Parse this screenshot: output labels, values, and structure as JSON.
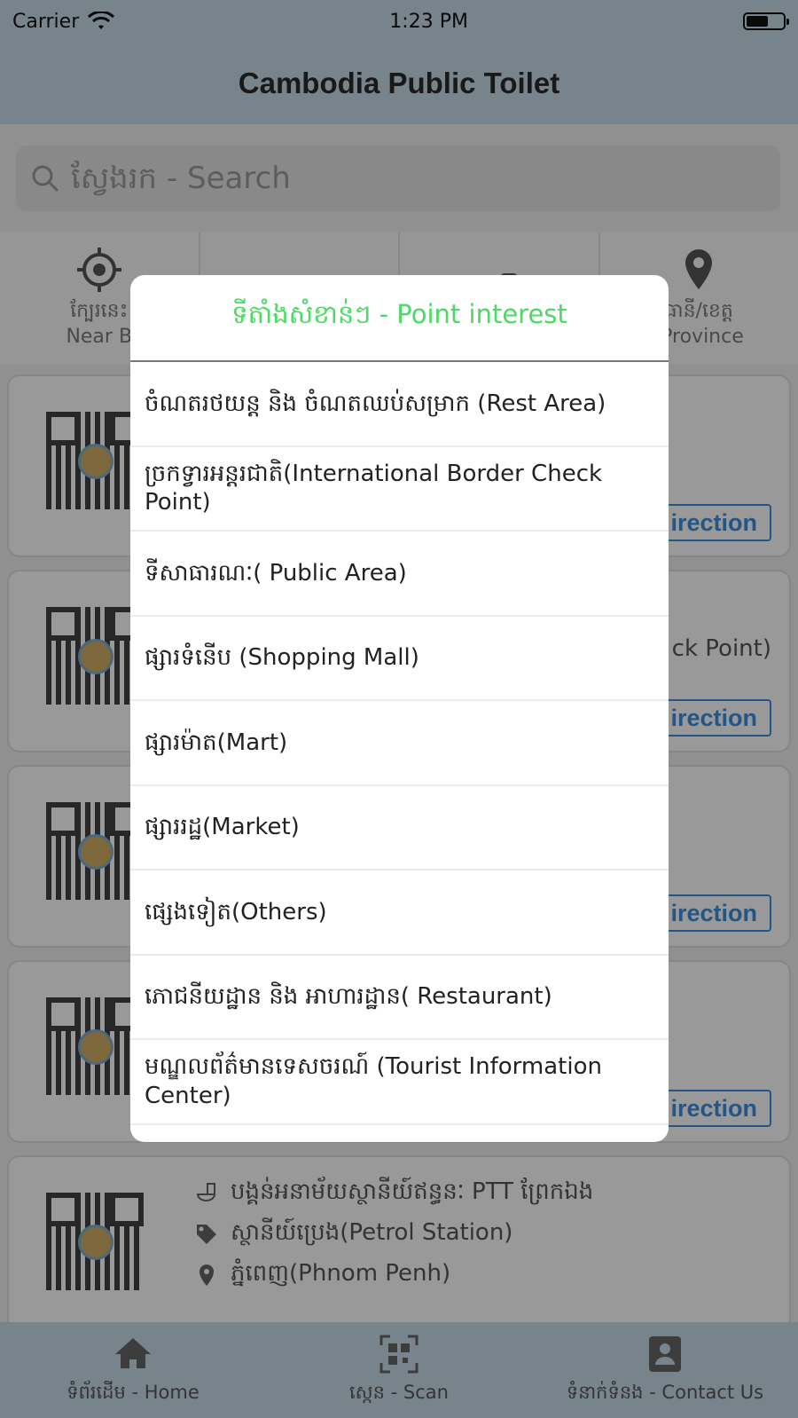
{
  "status_bar": {
    "carrier": "Carrier",
    "time": "1:23 PM"
  },
  "nav": {
    "title": "Cambodia Public Toilet"
  },
  "search": {
    "placeholder": "ស្វែងរក - Search"
  },
  "categories": [
    {
      "label": "ក្បែរនេះ",
      "sub": "Near By",
      "icon": "crosshair-icon"
    },
    {
      "label": "",
      "sub": "",
      "icon": "list-icon"
    },
    {
      "label": "",
      "sub": "",
      "icon": "toilet-icon"
    },
    {
      "label": "រាជធានី/ខេត្ត",
      "sub": "Capital/Province",
      "icon": "map-pin-icon"
    }
  ],
  "background_partial_text": {
    "check_point": "ck Point)",
    "direction": "irection",
    "category_1_visible": "ក្បែរនេះ",
    "category_1_sub_visible": "Near B",
    "category_4_visible": "ធានី/ខេត្ត",
    "category_4_sub_visible": "/Province"
  },
  "last_card": {
    "name": "បង្គន់អនាម័យស្ថានីយ៍ឥន្ធនៈ PTT ព្រែកឯង",
    "type": "ស្ថានីយ៍ប្រេង(Petrol Station)",
    "location": "ភ្នំពេញ(Phnom Penh)"
  },
  "dialog": {
    "title": "ទីតាំងសំខាន់ៗ - Point interest",
    "options": [
      "ចំណតរថយន្ត និង ចំណតឈប់សម្រាក (Rest Area)",
      "ច្រកទ្វារអន្តរជាតិ(International Border Check Point)",
      "ទីសាធារណៈ( Public Area)",
      "ផ្សារទំនើប (Shopping Mall)",
      "ផ្សារម៉ាត(Mart)",
      "ផ្សាររដ្ឋ(Market)",
      "ផ្សេងទៀត(Others)",
      "ភោជនីយដ្ឋាន និង អាហារដ្ឋាន( Restaurant)",
      "មណ្ឌលព័ត៌មានទេសចរណ៍ (Tourist Information Center)"
    ]
  },
  "tabbar": {
    "home": "ទំព័រដើម - Home",
    "scan": "ស្កេន - Scan",
    "contact": "ទំនាក់ទំនង - Contact Us"
  },
  "colors": {
    "accent_green": "#4cd964",
    "link_blue": "#3b8fe0",
    "bar_blue": "#c9dcea"
  }
}
